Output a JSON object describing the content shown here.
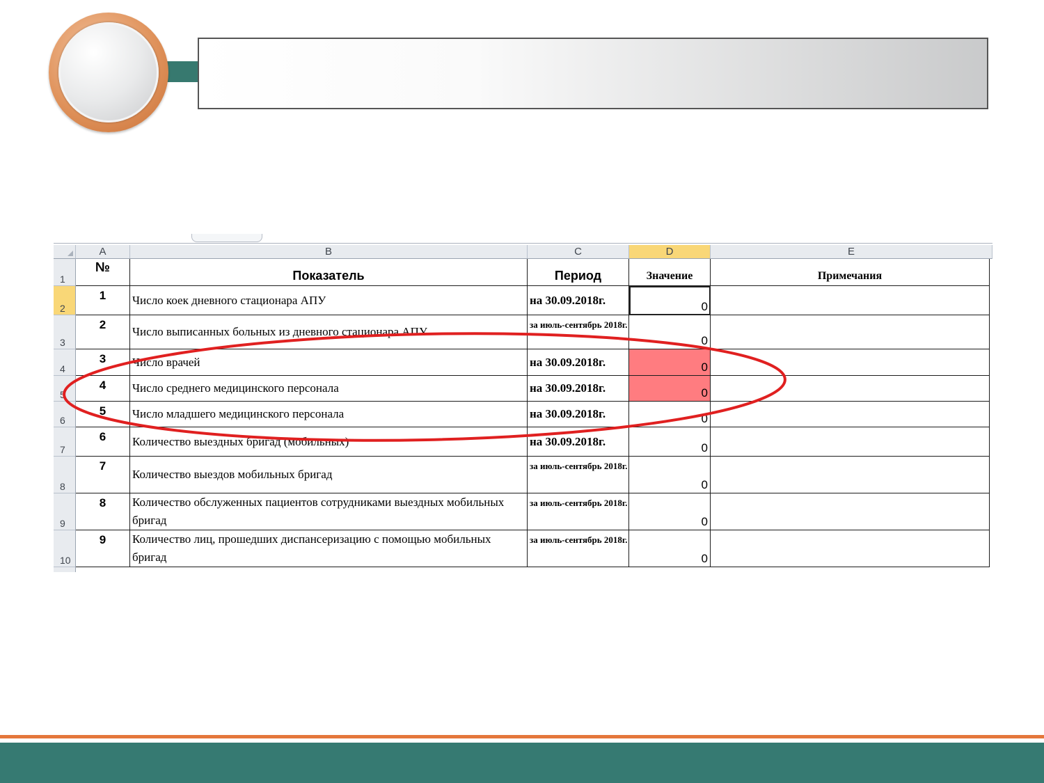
{
  "slide": {
    "title": ""
  },
  "sheet": {
    "columns": [
      "A",
      "B",
      "C",
      "D",
      "E"
    ],
    "selected_column": "D",
    "header_row_number": "1",
    "header": {
      "num": "№",
      "indicator": "Показатель",
      "period": "Период",
      "value": "Значение",
      "notes": "Примечания"
    },
    "rows": [
      {
        "row": "2",
        "num": "1",
        "indicator": "Число коек дневного стационара АПУ",
        "period": "на 30.09.2018г.",
        "value": "0",
        "note": ""
      },
      {
        "row": "3",
        "num": "2",
        "indicator": "Число выписанных больных из дневного стационара АПУ",
        "period": "за июль-сентябрь 2018г.",
        "value": "0",
        "note": ""
      },
      {
        "row": "4",
        "num": "3",
        "indicator": "Число врачей",
        "period": "на 30.09.2018г.",
        "value": "0",
        "note": ""
      },
      {
        "row": "5",
        "num": "4",
        "indicator": "Число среднего медицинского персонала",
        "period": "на 30.09.2018г.",
        "value": "0",
        "note": ""
      },
      {
        "row": "6",
        "num": "5",
        "indicator": "Число младшего медицинского персонала",
        "period": "на 30.09.2018г.",
        "value": "0",
        "note": ""
      },
      {
        "row": "7",
        "num": "6",
        "indicator": "Количество выездных бригад (мобильных)",
        "period": "на 30.09.2018г.",
        "value": "0",
        "note": ""
      },
      {
        "row": "8",
        "num": "7",
        "indicator": "Количество выездов мобильных бригад",
        "period": "за июль-сентябрь 2018г.",
        "value": "0",
        "note": ""
      },
      {
        "row": "9",
        "num": "8",
        "indicator": "Количество обслуженных пациентов сотрудниками выездных мобильных бригад",
        "period": "за июль-сентябрь 2018г.",
        "value": "0",
        "note": ""
      },
      {
        "row": "10",
        "num": "9",
        "indicator": "Количество лиц, прошедших диспансеризацию с помощью мобильных бригад",
        "period": "за июль-сентябрь 2018г.",
        "value": "0",
        "note": ""
      }
    ],
    "highlight_color": "#ff7c80",
    "annotation_color": "#e02020"
  }
}
